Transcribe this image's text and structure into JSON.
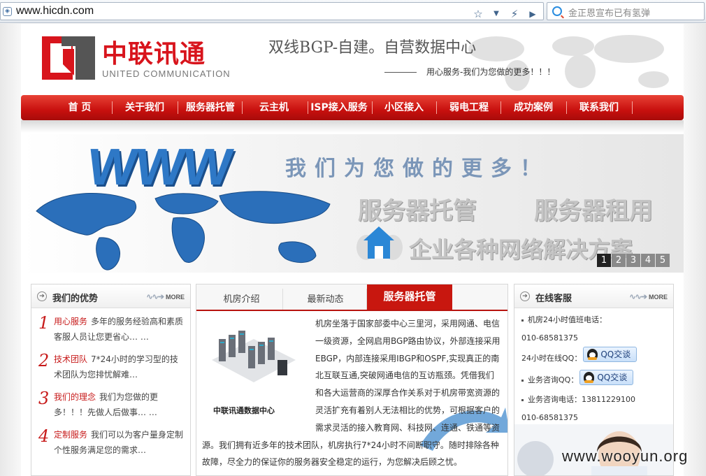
{
  "browser": {
    "url": "www.hicdn.com",
    "search_placeholder": "金正恩宣布已有氢弹"
  },
  "header": {
    "logo_cn": "中联讯通",
    "logo_en": "UNITED COMMUNICATION",
    "slogan": "双线BGP-自建。自营数据中心",
    "subslogan": "用心服务-我们为您做的更多！！！"
  },
  "nav": {
    "items": [
      {
        "label": "首 页"
      },
      {
        "label": "关于我们"
      },
      {
        "label": "服务器托管"
      },
      {
        "label": "云主机"
      },
      {
        "label": "ISP接入服务"
      },
      {
        "label": "小区接入"
      },
      {
        "label": "弱电工程"
      },
      {
        "label": "成功案例"
      },
      {
        "label": "联系我们"
      }
    ]
  },
  "banner": {
    "www_text": "WWW",
    "line1": "我们为您做的更多！",
    "line2a": "服务器托管",
    "line2b": "服务器租用",
    "line3": "企业各种网络解决方案",
    "pages": [
      "1",
      "2",
      "3",
      "4",
      "5"
    ],
    "active_page": 1
  },
  "advantages": {
    "title": "我们的优势",
    "more": "MORE",
    "items": [
      {
        "num": "1",
        "key": "用心服务",
        "text": "多年的服务经验高和素质客服人员让您更省心…  …"
      },
      {
        "num": "2",
        "key": "技术团队",
        "text": "7*24小时的学习型的技术团队为您排忧解难…"
      },
      {
        "num": "3",
        "key": "我们的理念",
        "text": "我们为您做的更多！！！先做人后做事…  …"
      },
      {
        "num": "4",
        "key": "定制服务",
        "text": "我们可以为客户量身定制个性服务满足您的需求…"
      }
    ]
  },
  "center": {
    "tabs": [
      {
        "label": "机房介绍"
      },
      {
        "label": "最新动态"
      },
      {
        "label": "服务器托管"
      }
    ],
    "image_caption": "中联讯通数据中心",
    "intro": "机房坐落于国家部委中心三里河，采用网通、电信一级资源，全网启用BGP路由协议，外部连接采用EBGP，内部连接采用IBGP和OSPF,实现真正的南北互联互通,突破网通电信的互访瓶颈。凭借我们和各大运营商的深厚合作关系对于机房带宽资源的灵活扩充有着别人无法相比的优势，可根据客户的需求灵活的接入教育网、科技网、连通、铁通等资源。我们拥有近多年的技术团队，机房执行7*24小时不间断职守。随时排除各种故障，尽全力的保证你的服务器安全稳定的运行，为您解决后顾之忧。"
  },
  "service": {
    "title": "在线客服",
    "more": "MORE",
    "line1": "机房24小时值班电话：",
    "line2": "010-68581375",
    "line3": "24小时在线QQ：",
    "line4": "业务咨询QQ：",
    "qq_label": "QQ交谈",
    "line5": "业务咨询电话：13811229100",
    "line6": "010-68581375"
  },
  "watermark": "www.wooyun.org",
  "colors": {
    "brand_red": "#c8170f",
    "link_red": "#c71a1a",
    "banner_blue": "#2e78c6"
  }
}
